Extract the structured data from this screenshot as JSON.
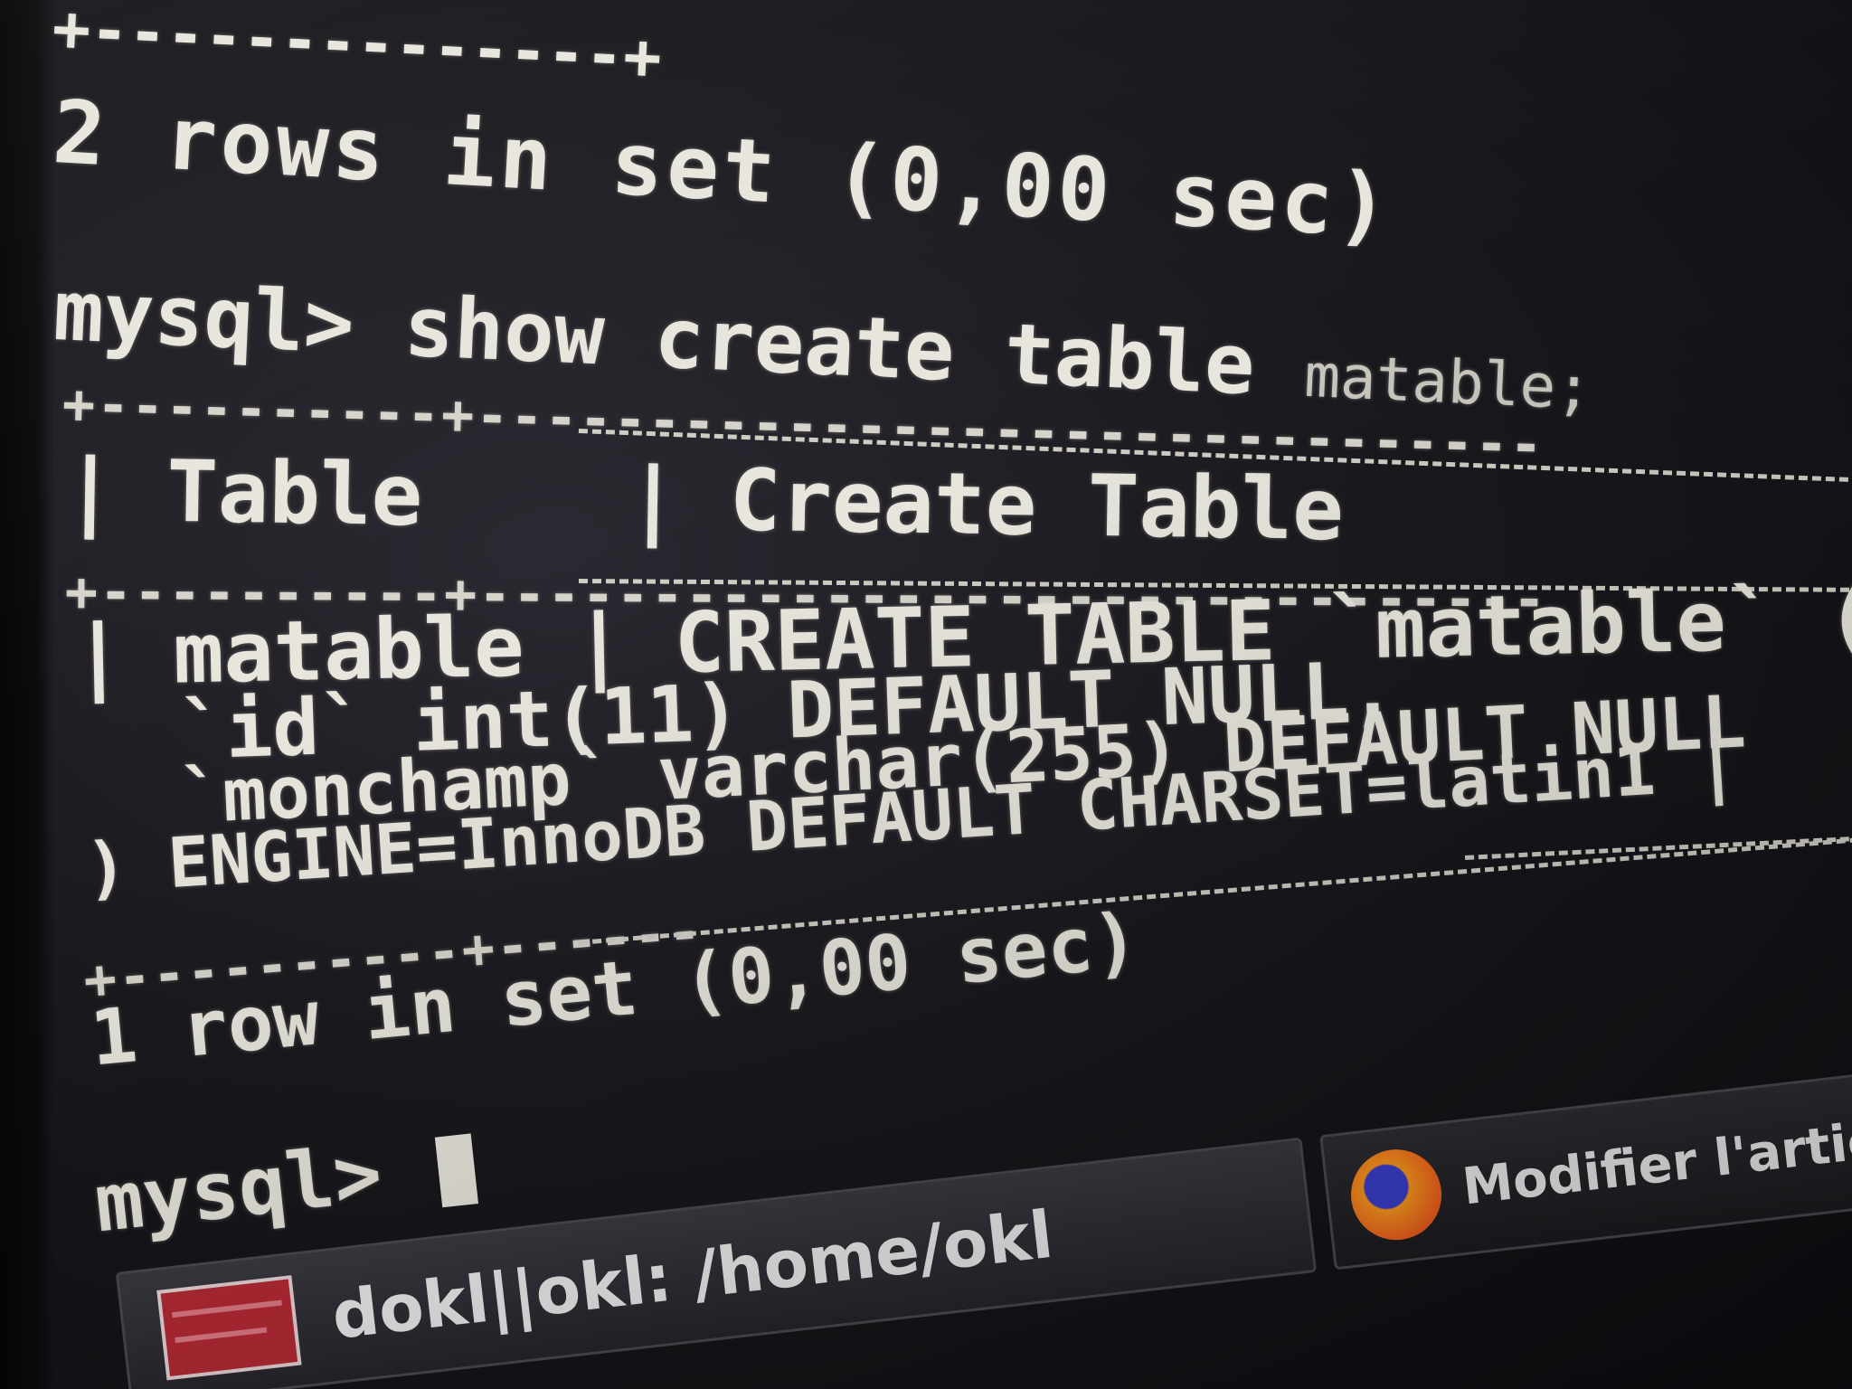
{
  "terminal": {
    "prev_border": "+--------------+",
    "prev_rows_count": "2 rows in set (0,00 sec)",
    "prompt": "mysql>",
    "command_main": "show create table",
    "command_arg": "matable;",
    "separator": "+----------+-------------------------------",
    "header_col1": "Table",
    "header_col2": "Create Table",
    "row_table": "matable",
    "create_line1": "CREATE TABLE `matable` (",
    "create_line2": "`id` int(11) DEFAULT NULL,",
    "create_line3_field": "`monchamp`",
    "create_line3_rest": "varchar(255) DEFAULT NULL",
    "create_line4_close": ")",
    "create_line4_engine": "ENGINE=InnoDB DEFAULT CHARSET=latin1 |",
    "separator_bottom": "+----------+------",
    "result_count": "1 row in set (0,00 sec)",
    "prompt2": "mysql>"
  },
  "taskbar": {
    "terminal_label": "dokl||okl: /home/okl",
    "firefox_label": "Modifier l'article ‹ Xavki — Wo"
  },
  "icons": {
    "terminal": "terminal-icon",
    "firefox": "firefox-icon"
  },
  "colors": {
    "text": "#e8e6dc",
    "background": "#1a191e"
  }
}
